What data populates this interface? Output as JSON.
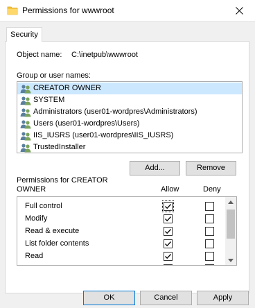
{
  "window": {
    "title": "Permissions for wwwroot"
  },
  "tabs": [
    {
      "label": "Security"
    }
  ],
  "object": {
    "label": "Object name:",
    "value": "C:\\inetpub\\wwwroot"
  },
  "groups": {
    "label": "Group or user names:",
    "items": [
      {
        "label": "CREATOR OWNER",
        "selected": true
      },
      {
        "label": "SYSTEM"
      },
      {
        "label": "Administrators (user01-wordpres\\Administrators)"
      },
      {
        "label": "Users (user01-wordpres\\Users)"
      },
      {
        "label": "IIS_IUSRS (user01-wordpres\\IIS_IUSRS)"
      },
      {
        "label": "TrustedInstaller"
      }
    ]
  },
  "buttons": {
    "add": "Add...",
    "remove": "Remove",
    "ok": "OK",
    "cancel": "Cancel",
    "apply": "Apply"
  },
  "permissions": {
    "heading_line1": "Permissions for CREATOR",
    "heading_line2": "OWNER",
    "allow_label": "Allow",
    "deny_label": "Deny",
    "rows": [
      {
        "name": "Full control",
        "allow": true,
        "deny": false
      },
      {
        "name": "Modify",
        "allow": true,
        "deny": false
      },
      {
        "name": "Read & execute",
        "allow": true,
        "deny": false
      },
      {
        "name": "List folder contents",
        "allow": true,
        "deny": false
      },
      {
        "name": "Read",
        "allow": true,
        "deny": false
      }
    ]
  },
  "icons": {
    "folder": "folder-icon",
    "close": "close-icon",
    "users": "users-icon",
    "check": "checkmark-icon"
  }
}
